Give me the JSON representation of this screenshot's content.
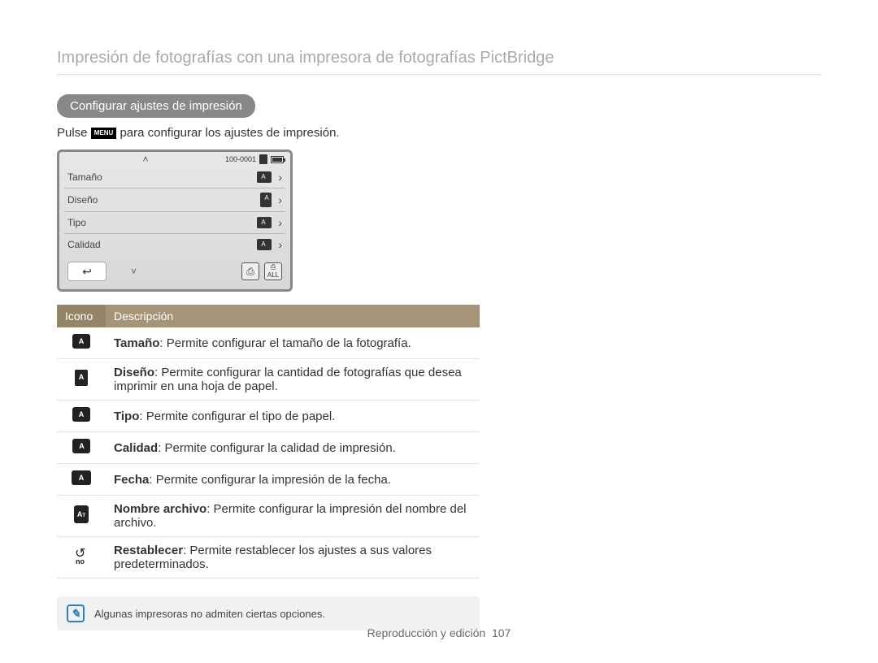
{
  "header": {
    "title": "Impresión de fotografías con una impresora de fotografías PictBridge"
  },
  "section": {
    "heading": "Configurar ajustes de impresión",
    "intro_prefix": "Pulse ",
    "intro_menu": "MENU",
    "intro_suffix": " para configurar los ajustes de impresión."
  },
  "screen": {
    "counter": "100-0001",
    "rows": [
      {
        "label": "Tamaño"
      },
      {
        "label": "Diseño"
      },
      {
        "label": "Tipo"
      },
      {
        "label": "Calidad"
      }
    ]
  },
  "table": {
    "head_icon": "Icono",
    "head_desc": "Descripción",
    "rows": [
      {
        "term": "Tamaño",
        "desc": ": Permite configurar el tamaño de la fotografía."
      },
      {
        "term": "Diseño",
        "desc": ": Permite configurar la cantidad de fotografías que desea imprimir en una hoja de papel."
      },
      {
        "term": "Tipo",
        "desc": ": Permite configurar el tipo de papel."
      },
      {
        "term": "Calidad",
        "desc": ": Permite configurar la calidad de impresión."
      },
      {
        "term": "Fecha",
        "desc": ": Permite configurar la impresión de la fecha."
      },
      {
        "term": "Nombre archivo",
        "desc": ": Permite configurar la impresión del nombre del archivo."
      },
      {
        "term": "Restablecer",
        "desc": ": Permite restablecer los ajustes a sus valores predeterminados."
      }
    ]
  },
  "note": {
    "text": "Algunas impresoras no admiten ciertas opciones."
  },
  "footer": {
    "section": "Reproducción y edición",
    "page": "107"
  }
}
